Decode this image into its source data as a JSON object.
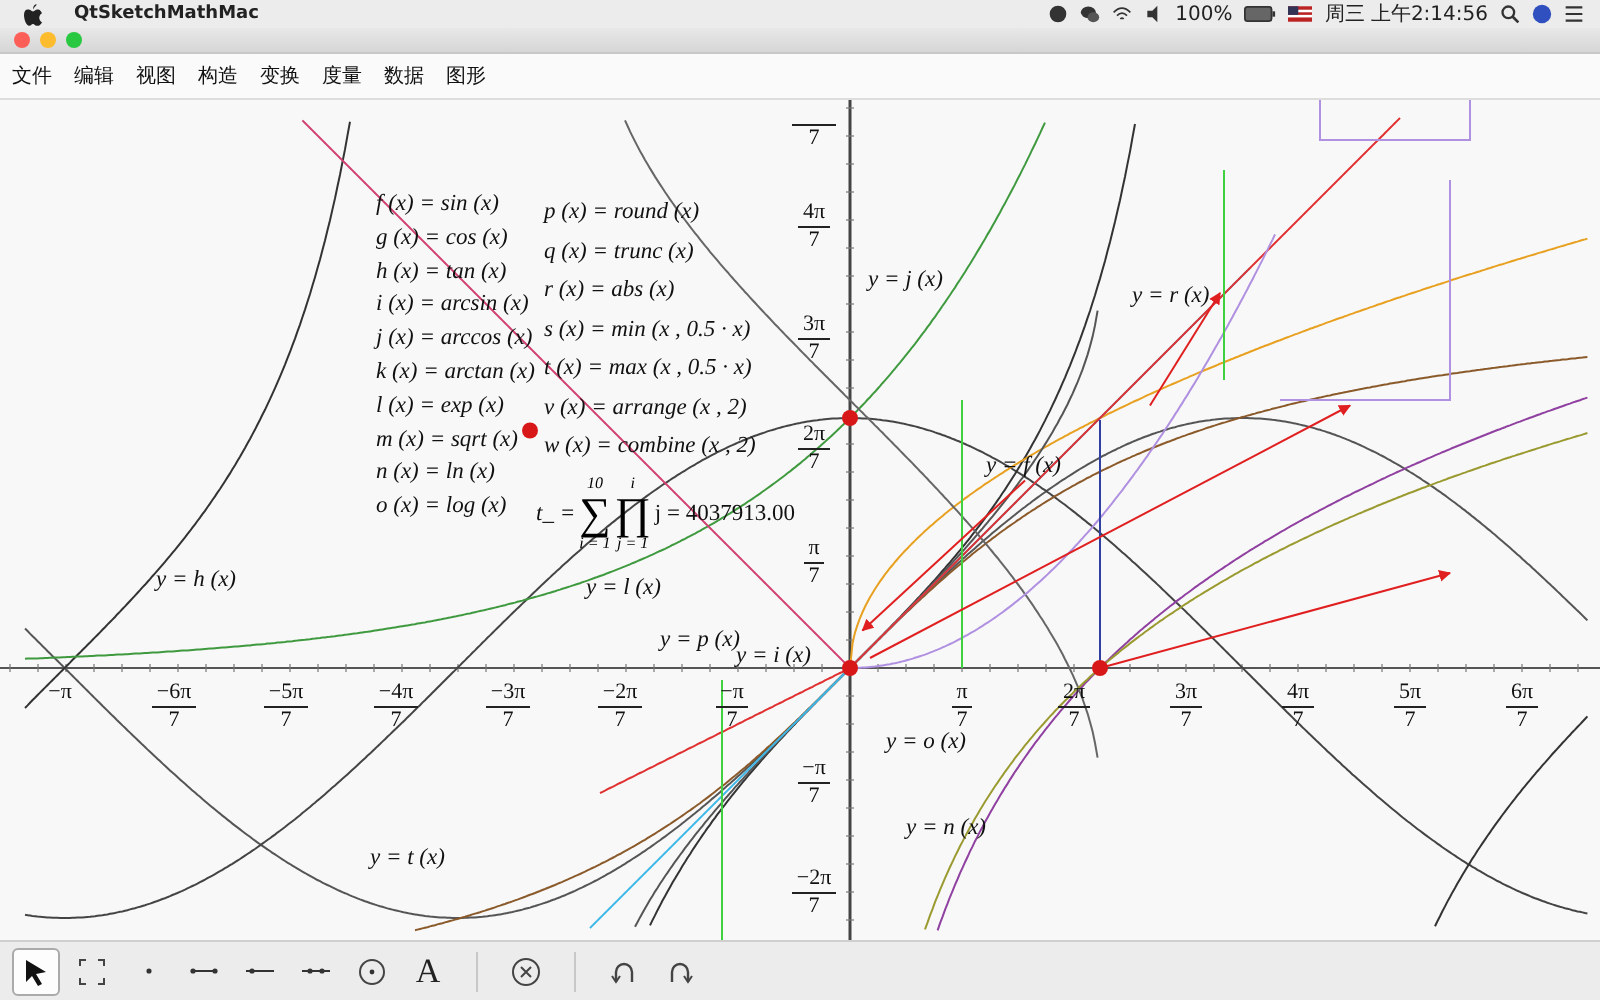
{
  "system_menu_bar": {
    "app_name": "QtSketchMathMac",
    "battery": "100%",
    "clock": "周三 上午2:14:56"
  },
  "menus": [
    "文件",
    "编辑",
    "视图",
    "构造",
    "变换",
    "度量",
    "数据",
    "图形"
  ],
  "canvas": {
    "x_ticks": [
      {
        "num": "−π"
      },
      {
        "num": "−6π",
        "den": "7"
      },
      {
        "num": "−5π",
        "den": "7"
      },
      {
        "num": "−4π",
        "den": "7"
      },
      {
        "num": "−3π",
        "den": "7"
      },
      {
        "num": "−2π",
        "den": "7"
      },
      {
        "num": "−π",
        "den": "7"
      },
      {
        "num": "π",
        "den": "7"
      },
      {
        "num": "2π",
        "den": "7"
      },
      {
        "num": "3π",
        "den": "7"
      },
      {
        "num": "4π",
        "den": "7"
      },
      {
        "num": "5π",
        "den": "7"
      },
      {
        "num": "6π",
        "den": "7"
      }
    ],
    "y_ticks": [
      {
        "den": "7"
      },
      {
        "num": "4π",
        "den": "7"
      },
      {
        "num": "3π",
        "den": "7"
      },
      {
        "num": "2π",
        "den": "7"
      },
      {
        "num": "π",
        "den": "7"
      },
      {
        "num": "−π",
        "den": "7"
      },
      {
        "num": "−2π",
        "den": "7"
      }
    ],
    "definitions_left": [
      "f (x) = sin (x)",
      "g (x) = cos (x)",
      "h (x) = tan (x)",
      "i (x) = arcsin (x)",
      "j (x) = arccos (x)",
      "k (x) = arctan (x)",
      "l (x) = exp (x)",
      "m (x) = sqrt (x)",
      "n (x) = ln (x)",
      "o (x) = log (x)"
    ],
    "definitions_right": [
      "p (x) = round (x)",
      "q (x) = trunc (x)",
      "r (x) = abs (x)",
      "s (x) = min (x , 0.5 · x)",
      "t (x) = max (x , 0.5 · x)",
      "v (x) = arrange (x , 2)",
      "w (x) = combine (x , 2)"
    ],
    "sum_formula": {
      "lhs": "t_ =",
      "sum_sign": "∑",
      "prod_sign": "∏",
      "sum_upper": "10",
      "sum_lower": "i = 1",
      "prod_upper": "i",
      "prod_lower": "j = 1",
      "rhs": "j = 4037913.00"
    },
    "curve_labels": [
      "y = h (x)",
      "y = j (x)",
      "y = r (x)",
      "y = f (x)",
      "y = l (x)",
      "y = p (x)",
      "y = i (x)",
      "y = o (x)",
      "y = n (x)",
      "y = t (x)"
    ]
  },
  "toolbar": {
    "tools": [
      {
        "kind": "pointer",
        "selected": true
      },
      {
        "kind": "marquee",
        "selected": false
      },
      {
        "kind": "point",
        "selected": false
      },
      {
        "kind": "segment",
        "selected": false
      },
      {
        "kind": "ray",
        "selected": false
      },
      {
        "kind": "line",
        "selected": false
      },
      {
        "kind": "circle",
        "selected": false
      },
      {
        "kind": "text",
        "label": "A",
        "selected": false
      },
      {
        "kind": "delete",
        "selected": false
      },
      {
        "kind": "undo",
        "selected": false
      },
      {
        "kind": "redo",
        "selected": false
      }
    ]
  }
}
